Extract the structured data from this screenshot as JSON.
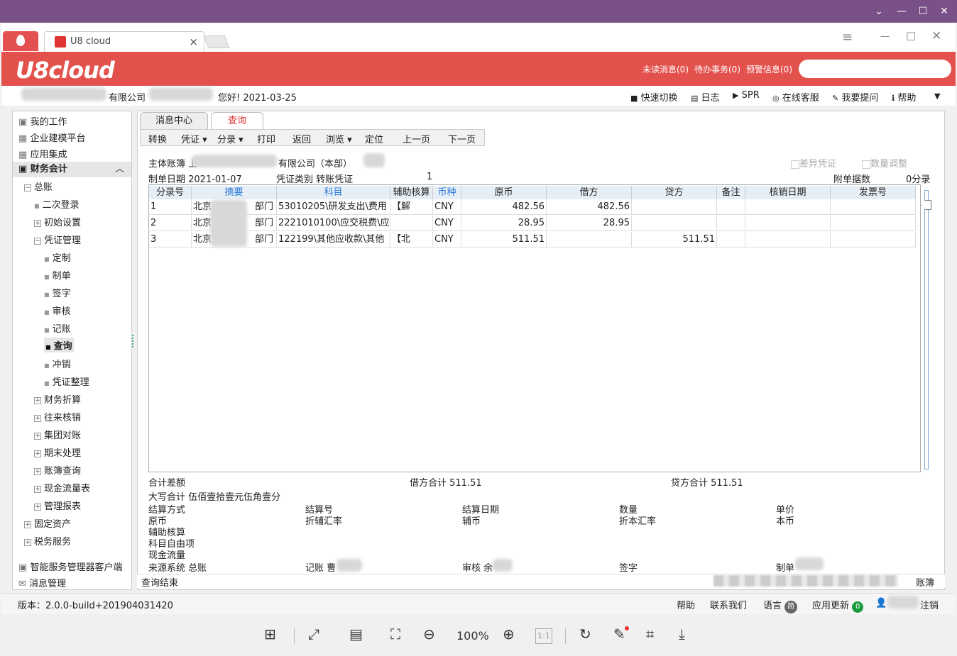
{
  "window": {
    "controls": [
      "chevron-down",
      "minimize",
      "maximize",
      "close"
    ]
  },
  "browser": {
    "tab_title": "U8 cloud",
    "tab_close": "×",
    "controls": {
      "menu": "≡",
      "min": "—",
      "max": "☐",
      "close": "✕"
    }
  },
  "header": {
    "logo": "U8cloud",
    "links": [
      "未读消息(0)",
      "待办事务(0)",
      "预警信息(0)"
    ]
  },
  "greeting": {
    "company_suffix": "有限公司",
    "hello": "您好! 2021-03-25",
    "tools": [
      "快速切换",
      "日志",
      "SPR",
      "在线客服",
      "我要提问",
      "帮助"
    ]
  },
  "sidebar": {
    "top": [
      "我的工作",
      "企业建模平台",
      "应用集成",
      "财务会计"
    ],
    "tree": [
      "总账",
      "二次登录",
      "初始设置",
      "凭证管理",
      "定制",
      "制单",
      "签字",
      "审核",
      "记账",
      "查询",
      "冲销",
      "凭证整理",
      "财务折算",
      "往来核销",
      "集团对账",
      "期末处理",
      "账簿查询",
      "现金流量表",
      "管理报表",
      "固定资产",
      "税务服务"
    ],
    "bottom": [
      "智能服务管理器客户端",
      "消息管理"
    ]
  },
  "main": {
    "tabs": [
      "消息中心",
      "查询"
    ],
    "toolbar": [
      "转换",
      "凭证 ▾",
      "分录 ▾",
      "打印",
      "返回",
      "浏览 ▾",
      "定位",
      "上一页",
      "下一页"
    ],
    "entity": "主体账簿 上",
    "entity_suffix": "有限公司（本部）",
    "diff_check": "差异凭证",
    "qty_adjust": "数量调整",
    "date_label": "制单日期 2021-01-07",
    "type_label": "凭证类别 转账凭证",
    "voucher_no": "1",
    "attach_label": "附单据数",
    "attach_value": "0分录",
    "columns": [
      "分录号",
      "摘要",
      "科目",
      "辅助核算",
      "币种",
      "原币",
      "借方",
      "贷方",
      "备注",
      "核销日期",
      "发票号"
    ],
    "rows": [
      [
        "1",
        "北京",
        "部门",
        "53010205\\研发支出\\费用",
        "【解",
        "CNY",
        "482.56",
        "482.56",
        "",
        "",
        "",
        ""
      ],
      [
        "2",
        "北京",
        "部门",
        "2221010100\\应交税费\\应",
        "",
        "CNY",
        "28.95",
        "28.95",
        "",
        "",
        "",
        ""
      ],
      [
        "3",
        "北京",
        "部门",
        "122199\\其他应收款\\其他",
        "【北",
        "CNY",
        "511.51",
        "",
        "511.51",
        "",
        "",
        ""
      ]
    ],
    "total_diff": "合计差额",
    "debit_total": "借方合计 511.51",
    "credit_total": "贷方合计 511.51",
    "capital": "大写合计 伍佰壹拾壹元伍角壹分",
    "detail": [
      [
        "结算方式",
        "结算号",
        "结算日期",
        "数量",
        "单价"
      ],
      [
        "原币",
        "折辅汇率",
        "辅币",
        "折本汇率",
        "本币"
      ],
      [
        "辅助核算",
        "",
        "",
        "",
        ""
      ],
      [
        "科目自由项",
        "",
        "",
        "",
        ""
      ],
      [
        "现金流量",
        "",
        "",
        "",
        ""
      ]
    ],
    "sign": [
      "来源系统 总账",
      "记账 曹",
      "审核 余",
      "签字",
      "制单"
    ],
    "status": "查询结束",
    "status_right": "账簿"
  },
  "footer": {
    "version": "版本：2.0.0-build+201904031420",
    "help": "帮助",
    "contact": "联系我们",
    "lang": "语言",
    "lang_badge": "简",
    "update": "应用更新",
    "update_count": "0",
    "logout": "注销"
  },
  "viewer": {
    "zoom": "100%"
  }
}
